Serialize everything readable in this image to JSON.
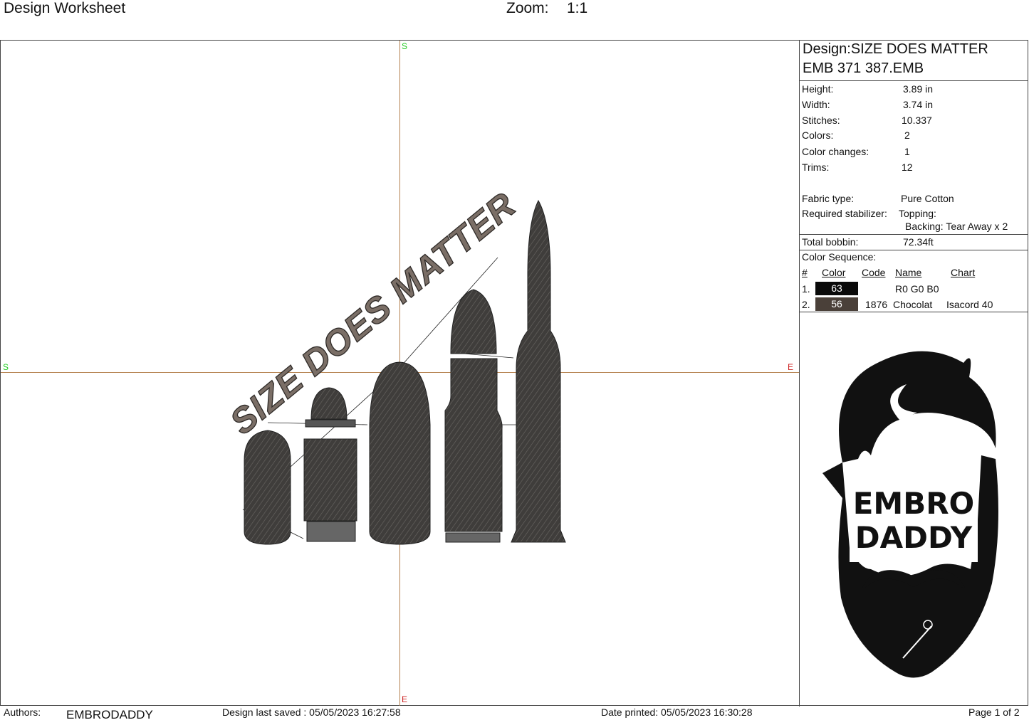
{
  "header": {
    "title": "Design Worksheet",
    "zoom_label": "Zoom:",
    "zoom_value": "1:1"
  },
  "canvas": {
    "markers": {
      "start": "S",
      "end": "E"
    },
    "design_text": "SIZE DOES MATTER",
    "thread_colors": {
      "black": "#0a0a0a",
      "chocolate": "#4a4039",
      "bullet_fill": "#3c3a38",
      "text_fill": "#7a6e66"
    }
  },
  "design": {
    "name_line": "Design:SIZE DOES MATTER",
    "file_line": "EMB 371 387.EMB",
    "specs": [
      {
        "label": "Height:",
        "value": "3.89 in"
      },
      {
        "label": "Width:",
        "value": "3.74 in"
      },
      {
        "label": "Stitches:",
        "value": "10.337"
      },
      {
        "label": "Colors:",
        "value": "2"
      },
      {
        "label": "Color changes:",
        "value": "1"
      },
      {
        "label": "Trims:",
        "value": "12"
      }
    ],
    "fabric_label": "Fabric type:",
    "fabric_value": "Pure Cotton",
    "stabilizer_label": "Required stabilizer:",
    "topping": "Topping:",
    "backing": "Backing: Tear Away x 2",
    "bobbin_label": "Total bobbin:",
    "bobbin_value": "72.34ft"
  },
  "color_sequence": {
    "title": "Color Sequence:",
    "headers": {
      "num": "#",
      "color": "Color",
      "code": "Code",
      "name": "Name",
      "chart": "Chart"
    },
    "rows": [
      {
        "num": "1.",
        "swatch": "63",
        "swatch_color": "#0a0a0a",
        "code": "",
        "name": "R0 G0 B0",
        "chart": ""
      },
      {
        "num": "2.",
        "swatch": "56",
        "swatch_color": "#4a4039",
        "code": "1876",
        "name": "Chocolat",
        "chart": "Isacord 40"
      }
    ]
  },
  "logo": {
    "line1": "EMBRO",
    "line2": "DADDY"
  },
  "footer": {
    "authors_label": "Authors:",
    "authors_value": "EMBRODADDY",
    "saved": "Design last saved : 05/05/2023 16:27:58",
    "printed": "Date printed: 05/05/2023 16:30:28",
    "page": "Page 1 of 2"
  }
}
